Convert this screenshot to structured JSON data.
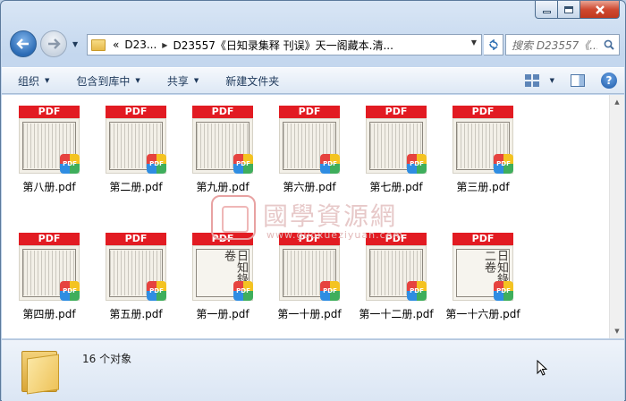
{
  "window": {
    "caption": {
      "min_icon": "minimize-icon",
      "max_icon": "maximize-icon",
      "close_icon": "close-icon"
    }
  },
  "nav": {
    "back_icon": "back-arrow-icon",
    "forward_icon": "forward-arrow-icon",
    "breadcrumb_prefix": "«",
    "crumbs": [
      "D23...",
      "D23557《日知录集释 刊误》天一阁藏本.清..."
    ],
    "refresh_icon": "refresh-icon",
    "search_placeholder": "搜索 D23557《...",
    "search_icon": "magnifier-icon"
  },
  "toolbar": {
    "organize": "组织",
    "include_library": "包含到库中",
    "share": "共享",
    "new_folder": "新建文件夹",
    "view_icon": "view-options-icon",
    "preview_pane_icon": "preview-pane-icon",
    "help_label": "?"
  },
  "files": [
    {
      "name": "第八册.pdf",
      "badge": "PDF",
      "thumb": "text"
    },
    {
      "name": "第二册.pdf",
      "badge": "PDF",
      "thumb": "text"
    },
    {
      "name": "第九册.pdf",
      "badge": "PDF",
      "thumb": "text"
    },
    {
      "name": "第六册.pdf",
      "badge": "PDF",
      "thumb": "text"
    },
    {
      "name": "第七册.pdf",
      "badge": "PDF",
      "thumb": "text"
    },
    {
      "name": "第三册.pdf",
      "badge": "PDF",
      "thumb": "text"
    },
    {
      "name": "第四册.pdf",
      "badge": "PDF",
      "thumb": "text"
    },
    {
      "name": "第五册.pdf",
      "badge": "PDF",
      "thumb": "text"
    },
    {
      "name": "第一册.pdf",
      "badge": "PDF",
      "thumb": "cover",
      "cover_text": "日知錄十卷"
    },
    {
      "name": "第一十册.pdf",
      "badge": "PDF",
      "thumb": "text"
    },
    {
      "name": "第一十二册.pdf",
      "badge": "PDF",
      "thumb": "text"
    },
    {
      "name": "第一十六册.pdf",
      "badge": "PDF",
      "thumb": "cover",
      "cover_text": "日知錄誤二卷"
    }
  ],
  "watermark": {
    "title": "國學資源網",
    "url": "www.guoxueziyuan.com"
  },
  "details": {
    "count_text": "16 个对象"
  },
  "colors": {
    "pdf_red": "#e21b22",
    "accent": "#2b6bb5"
  }
}
